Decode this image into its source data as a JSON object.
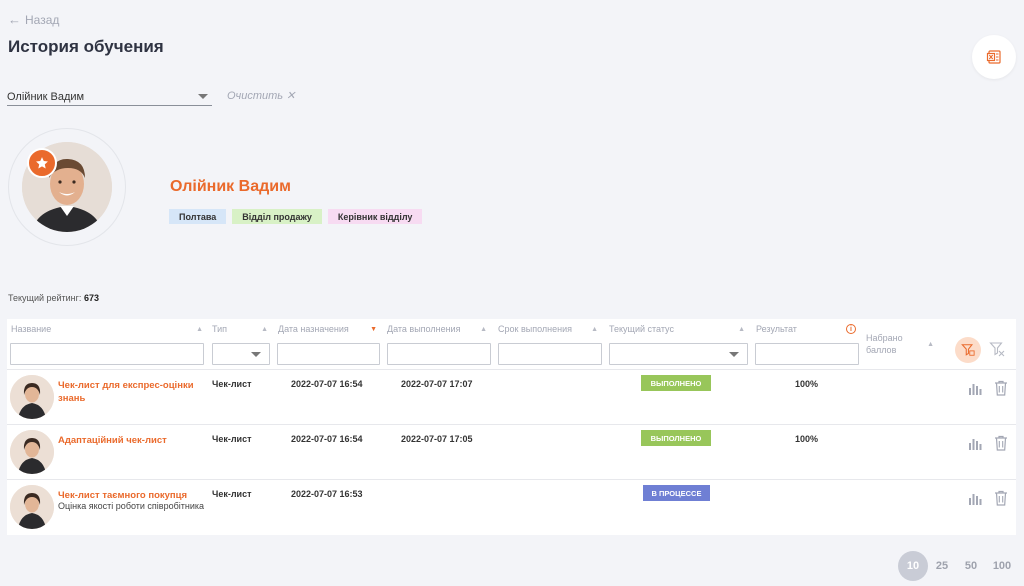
{
  "nav": {
    "back_label": "Назад"
  },
  "page": {
    "title": "История обучения"
  },
  "filter": {
    "selected_user": "Олійник Вадим",
    "clear_label": "Очистить"
  },
  "profile": {
    "name": "Олійник Вадим",
    "tags": [
      {
        "label": "Полтава",
        "color": "#d6e6f8"
      },
      {
        "label": "Відділ продажу",
        "color": "#d8f1c6"
      },
      {
        "label": "Керівник відділу",
        "color": "#f7dbf2"
      }
    ]
  },
  "rating": {
    "label": "Текущий рейтинг:",
    "value": "673"
  },
  "table": {
    "columns": [
      "Название",
      "Тип",
      "Дата назначения",
      "Дата выполнения",
      "Срок выполнения",
      "Текущий статус",
      "Результат",
      "Набрано баллов"
    ],
    "rows": [
      {
        "title": "Чек-лист для експрес-оцінки знань",
        "subtitle": "",
        "type": "Чек-лист",
        "assigned": "2022-07-07 16:54",
        "completed": "2022-07-07 17:07",
        "deadline": "",
        "status": "ВЫПОЛНЕНО",
        "result": "100%"
      },
      {
        "title": "Адаптаційний чек-лист",
        "subtitle": "",
        "type": "Чек-лист",
        "assigned": "2022-07-07 16:54",
        "completed": "2022-07-07 17:05",
        "deadline": "",
        "status": "ВЫПОЛНЕНО",
        "result": "100%"
      },
      {
        "title": "Чек-лист таємного покупця",
        "subtitle": "Оцінка якості роботи співробітника",
        "type": "Чек-лист",
        "assigned": "2022-07-07 16:53",
        "completed": "",
        "deadline": "",
        "status": "В ПРОЦЕССЕ",
        "result": ""
      }
    ]
  },
  "pagination": {
    "options": [
      "10",
      "25",
      "50",
      "100"
    ],
    "selected": "10"
  },
  "colors": {
    "accent": "#ea6a2c",
    "done": "#98c65a",
    "in_progress": "#6f7fd4"
  },
  "icons": [
    "arrow-left-icon",
    "excel-icon",
    "star-icon",
    "filter-icon",
    "filter-clear-icon",
    "bar-chart-icon",
    "trash-icon",
    "info-icon",
    "sort-icon"
  ]
}
